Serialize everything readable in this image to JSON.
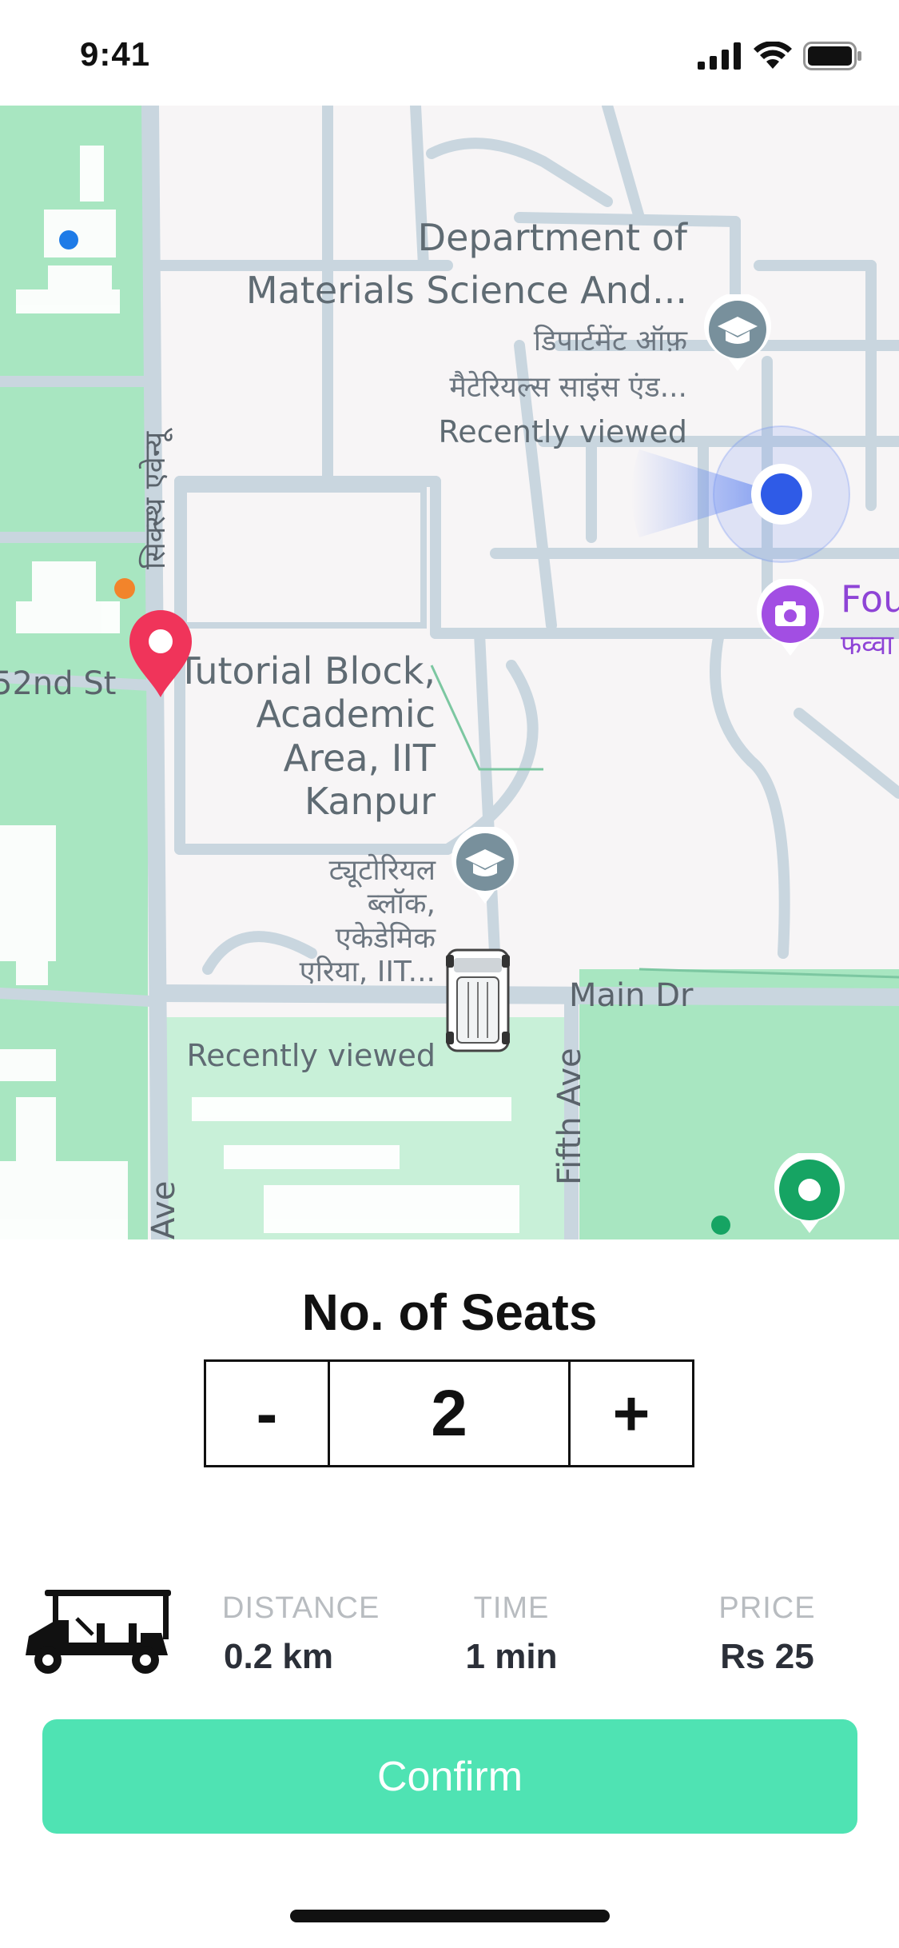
{
  "status_bar": {
    "time": "9:41"
  },
  "map": {
    "labels": {
      "dept_en_1": "Department of",
      "dept_en_2": "Materials Science And...",
      "dept_hi_1": "डिपार्टमेंट ऑफ़",
      "dept_hi_2": "मैटेरियल्स साइंस एंड...",
      "dept_recent": "Recently viewed",
      "tutorial_en": "Tutorial Block, Academic Area, IIT Kanpur",
      "tutorial_hi": "ट्यूटोरियल ब्लॉक, एकेडेमिक एरिया, IIT...",
      "tutorial_recent": "Recently viewed",
      "road_main": "Main Dr",
      "road_fifth": "Fifth Ave",
      "road_52nd": "52nd St",
      "road_ave": "Ave",
      "road_hindi": "सिक्स्थ एवेन्यू",
      "fountain_en": "Fou",
      "fountain_hi": "फव्वा"
    }
  },
  "seats": {
    "title": "No. of Seats",
    "decrement": "-",
    "value": "2",
    "increment": "+"
  },
  "trip": {
    "distance_label": "DISTANCE",
    "distance_value": "0.2 km",
    "time_label": "TIME",
    "time_value": "1 min",
    "price_label": "PRICE",
    "price_value": "Rs 25"
  },
  "confirm_label": "Confirm",
  "colors": {
    "accent": "#4fe3b3",
    "pin_red": "#f0345a",
    "location_blue": "#2f5be7",
    "park_green": "#a8e6c1"
  }
}
